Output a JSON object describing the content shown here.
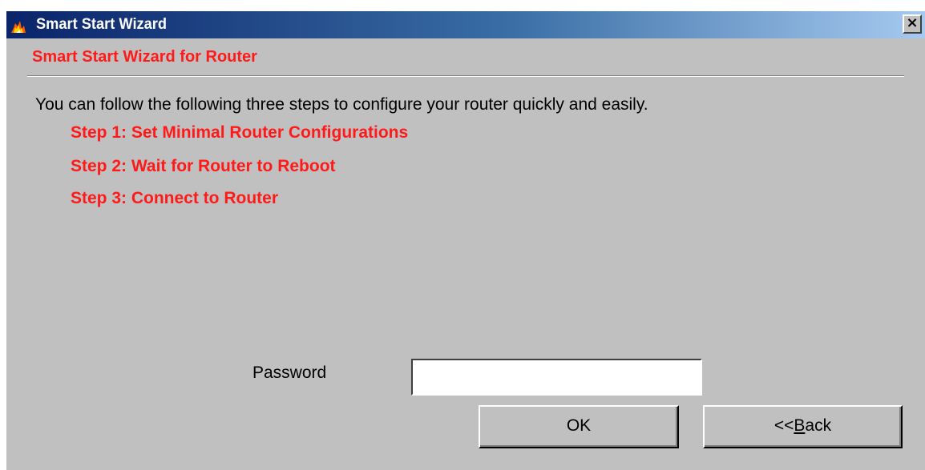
{
  "window": {
    "title": "Smart Start Wizard",
    "close_label": "×"
  },
  "header": {
    "subtitle": "Smart Start Wizard for Router"
  },
  "main": {
    "intro": "You can follow the following three steps to configure your router quickly and easily.",
    "steps": [
      "Step 1: Set Minimal Router Configurations",
      "Step 2: Wait for Router to Reboot",
      "Step 3: Connect to Router"
    ]
  },
  "form": {
    "password_label": "Password",
    "password_value": "",
    "ok_label": "OK",
    "back_prefix": "<<",
    "back_accel": "B",
    "back_rest": "ack"
  },
  "colors": {
    "title_gradient_start": "#0a246a",
    "title_gradient_end": "#a6caf0",
    "accent_red": "#ff1a1a",
    "window_face": "#c0c0c0"
  },
  "icons": {
    "app": "fire-icon",
    "close": "close-icon"
  }
}
